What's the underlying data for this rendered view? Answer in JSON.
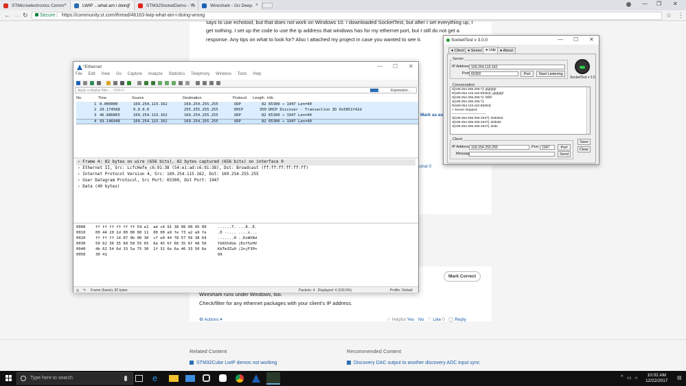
{
  "browser": {
    "tabs": [
      {
        "label": "STMicroelectronics Comm",
        "color": "#d93025"
      },
      {
        "label": "LWIP ...what am i doing",
        "color": "#2a6db3"
      },
      {
        "label": "STM32SocketDemo - Yo",
        "color": "#e62117"
      },
      {
        "label": "Wireshark - Go Deep.",
        "color": "#1a5fb4"
      }
    ],
    "secure_label": "Secure",
    "url": "https://community.st.com/thread/46163-lwip-what-am-i-doing-wrong",
    "colors": {
      "secure": "#0b8043",
      "link": "#1a5aa5"
    }
  },
  "post": {
    "lines": [
      "says to use echotool, but that does not work on Windows 10. I downloaded SocketTest, but after I set everything up, I",
      "get nothing. I set up the code to use the ip address that windows has for my ethernet port, but I still do not get a",
      "response. Any tips on what to look for? Also I attached my project in case you wanted to see it."
    ],
    "mark_as_answer": "Mark as assu",
    "neutral": "utral 0"
  },
  "reply": {
    "mark_correct": "Mark Correct",
    "lines": [
      "Wireshark runs under Windows, too.",
      "Check/filter for any ethernet packages with your client's IP address."
    ],
    "actions": "Actions",
    "helpful": "Helpful",
    "yes": "Yes",
    "no": "No",
    "like": "Like",
    "like_count": "0",
    "replies": "Reply"
  },
  "related": {
    "heading": "Related Content",
    "link": "STM32Cube LwIP demos not working"
  },
  "recommended": {
    "heading": "Recommended Content",
    "link": "Discovery DAC output to another discovery ADC input sync"
  },
  "wireshark": {
    "title": "*Ethernet",
    "menu": [
      "File",
      "Edit",
      "View",
      "Go",
      "Capture",
      "Analyze",
      "Statistics",
      "Telephony",
      "Wireless",
      "Tools",
      "Help"
    ],
    "filter_placeholder": "Apply a display filter ... <Ctrl-/>",
    "expression": "Expression...",
    "columns": [
      "No.",
      "Time",
      "Source",
      "Destination",
      "Protocol",
      "Length",
      "Info"
    ],
    "packets": [
      {
        "no": "1",
        "time": "0.000000",
        "src": "169.254.115.162",
        "dst": "169.254.255.255",
        "proto": "UDP",
        "len": "82",
        "info": "65300 → 1947 Len=40"
      },
      {
        "no": "2",
        "time": "29.174568",
        "src": "0.0.0.0",
        "dst": "255.255.255.255",
        "proto": "DHCP",
        "len": "350",
        "info": "DHCP Discover - Transaction ID 0x5851f42d"
      },
      {
        "no": "3",
        "time": "46.886865",
        "src": "169.254.115.162",
        "dst": "169.254.255.255",
        "proto": "UDP",
        "len": "82",
        "info": "65300 → 1947 Len=40"
      },
      {
        "no": "4",
        "time": "93.146948",
        "src": "169.254.115.162",
        "dst": "169.254.255.255",
        "proto": "UDP",
        "len": "82",
        "info": "65300 → 1947 Len=40"
      }
    ],
    "details": [
      "Frame 4: 82 bytes on wire (656 bits), 82 bytes captured (656 bits) on interface 0",
      "Ethernet II, Src: LcfcHefe_c6:91:38 (54:e1:ad:c6:91:38), Dst: Broadcast (ff:ff:ff:ff:ff:ff)",
      "Internet Protocol Version 4, Src: 169.254.115.162, Dst: 169.254.255.255",
      "User Datagram Protocol, Src Port: 65300, Dst Port: 1947",
      "Data (40 bytes)"
    ],
    "hex": [
      {
        "off": "0000",
        "bytes": "ff ff ff ff ff ff 54 e1  ad c6 91 38 08 00 45 00",
        "ascii": "......T. ...8..E."
      },
      {
        "off": "0010",
        "bytes": "00 44 20 2d 00 00 80 11  00 00 a9 fe 73 a2 a9 fe",
        "ascii": ".D -.... ....s..."
      },
      {
        "off": "0020",
        "bytes": "ff ff ff 14 07 9b 00 30  c7 e0 44 78 57 56 38 64",
        "ascii": ".......0 ..DxWV8d"
      },
      {
        "off": "0030",
        "bytes": "59 62 36 35 68 58 55 65  6a 45 6f 66 35 6f 48 56",
        "ascii": "Yb65hXUe jEof5oHV"
      },
      {
        "off": "0040",
        "bytes": "4b 62 54 6d 33 5a 75 30  2f 32 6e 6a 46 33 50 6e",
        "ascii": "KbTm3Zu0 /2njF3Pn"
      },
      {
        "off": "0050",
        "bytes": "30 41",
        "ascii": "0A"
      }
    ],
    "status_left": "Frame (frame), 82 bytes",
    "status_mid": "Packets: 4 · Displayed: 4 (100.0%)",
    "status_right": "Profile: Default",
    "colors": {
      "row_udp": "#daeeff",
      "row_selected": "#cde6ff",
      "details_selected": "#e6e6e6"
    }
  },
  "sockettest": {
    "title": "SocketTest v 3.0.0",
    "tabs": [
      "Client",
      "Server",
      "Udp",
      "About"
    ],
    "active_tab": "Udp",
    "server_label": "Server",
    "ip_label": "IP Address",
    "server_ip": "169.254.115.162",
    "port_label": "Port",
    "server_port": "65300",
    "port_btn": "Port",
    "start_btn": "Start Listening",
    "logo_caption": "SocketTest v 3.0",
    "conversation_label": "Conversation",
    "conversation": [
      "S[169.254.255.255:?]: gfgfgfgf",
      "R[169.254.115.162:65354]: gfgfgfgf",
      "S[169.254.255.255:?]: fdfdf",
      "S[169.254.255.255:?]:",
      "R[169.254.115.162:65354]:",
      "> Server stopped",
      "-------------------------------",
      "S[169.254.255.255:1947]: dsdsdsd",
      "S[169.254.255.255:1947]: dsdsds",
      "S[169.254.255.255:1947]: dsds"
    ],
    "client_label": "Client",
    "client_ip": "169.254.255.255",
    "client_port": "1947",
    "message_label": "Message",
    "send_btn": "Send",
    "save_btn": "Save",
    "clear_btn": "Clear"
  },
  "taskbar": {
    "search_placeholder": "Type here to search",
    "time": "10:02 AM",
    "date": "12/22/2017"
  }
}
